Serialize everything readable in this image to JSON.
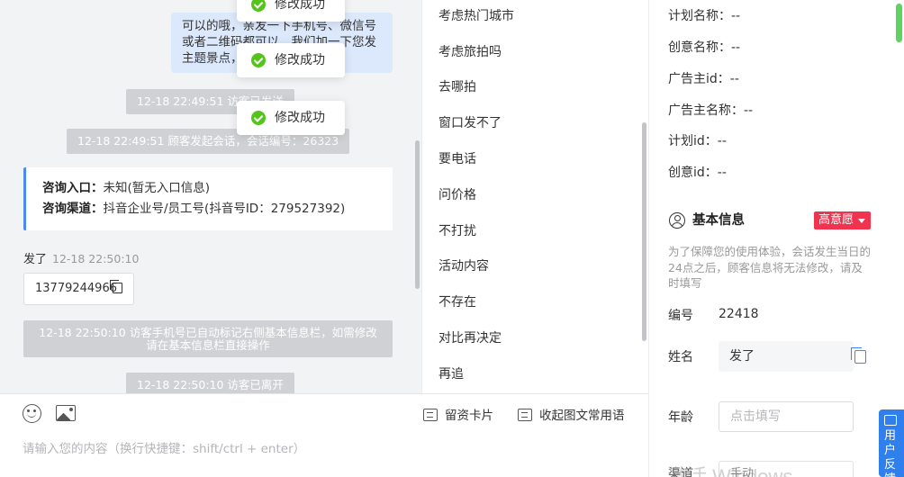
{
  "chat": {
    "agent_message": "可以的哦，亲发一下手机号、微信号或者二维码都可以，我们加一下您发主题景点，我们了解下",
    "system_messages": [
      "12-18 22:49:51 访客已发送",
      "12-18 22:49:51 顾客发起会话，会话编号：26323",
      "12-18 22:50:10 访客手机号已自动标记右侧基本信息栏，如需修改请在基本信息栏直接操作",
      "12-18 22:50:10 访客已离开"
    ],
    "source_card": {
      "entry_label": "咨询入口：",
      "entry_value": "未知(暂无入口信息)",
      "channel_label": "咨询渠道：",
      "channel_value": "抖音企业号/员工号(抖音号ID：279527392)"
    },
    "visitor_name": "发了",
    "visitor_time": "12-18 22:50:10",
    "phone_message": "13779244966"
  },
  "toasts": [
    "修改成功",
    "修改成功",
    "修改成功"
  ],
  "input": {
    "placeholder": "请输入您的内容（换行快捷键：shift/ctrl + enter）",
    "lead_card_label": "留资卡片",
    "collapse_label": "收起图文常用语"
  },
  "quick_replies": [
    "考虑热门城市",
    "考虑旅拍吗",
    "去哪拍",
    "窗口发不了",
    "要电话",
    "问价格",
    "不打扰",
    "活动内容",
    "不存在",
    "对比再决定",
    "再追"
  ],
  "info": {
    "ad_fields": [
      {
        "label": "计划名称：",
        "value": "--"
      },
      {
        "label": "创意名称：",
        "value": "--"
      },
      {
        "label": "广告主id：",
        "value": "--"
      },
      {
        "label": "广告主名称：",
        "value": "--"
      },
      {
        "label": "计划id：",
        "value": "--"
      },
      {
        "label": "创意id：",
        "value": "--"
      }
    ],
    "section_title": "基本信息",
    "intent_badge": "高意愿",
    "notice": "为了保障您的使用体验，会话发生当日的24点之后，顾客信息将无法修改，请及时填写",
    "id_label": "编号",
    "id_value": "22418",
    "name_label": "姓名",
    "name_value": "发了",
    "age_label": "年龄",
    "age_placeholder": "点击填写",
    "partial_label": "渠道",
    "partial_value": "手动",
    "watermark": "激活 Windows"
  },
  "feedback": {
    "label": "用户反馈"
  },
  "colors": {
    "accent": "#4a8af4",
    "badge": "#f0334f",
    "success": "#52c41a",
    "bubble": "#dce8fb"
  }
}
